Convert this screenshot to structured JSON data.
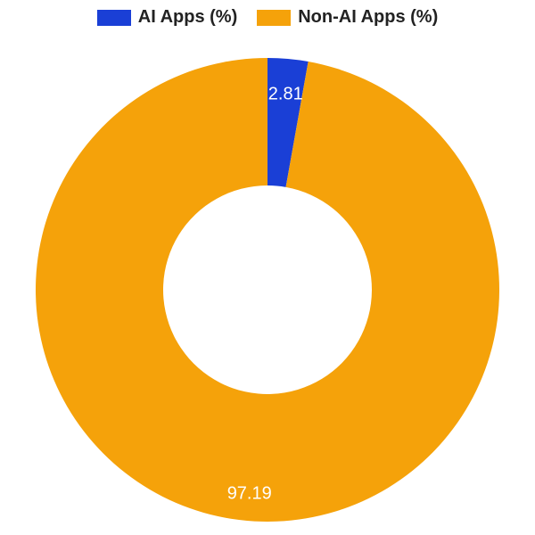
{
  "chart_data": {
    "type": "pie",
    "title": "",
    "series": [
      {
        "name": "AI Apps (%)",
        "value": 2.81,
        "color": "#1a3fd6"
      },
      {
        "name": "Non-AI Apps (%)",
        "value": 97.19,
        "color": "#f5a20a"
      }
    ],
    "donut_inner_ratio": 0.45,
    "legend_position": "top"
  },
  "legend": {
    "items": [
      {
        "label": "AI Apps (%)",
        "color": "#1a3fd6"
      },
      {
        "label": "Non-AI Apps (%)",
        "color": "#f5a20a"
      }
    ]
  },
  "labels": {
    "ai_value": "2.81",
    "nonai_value": "97.19"
  }
}
